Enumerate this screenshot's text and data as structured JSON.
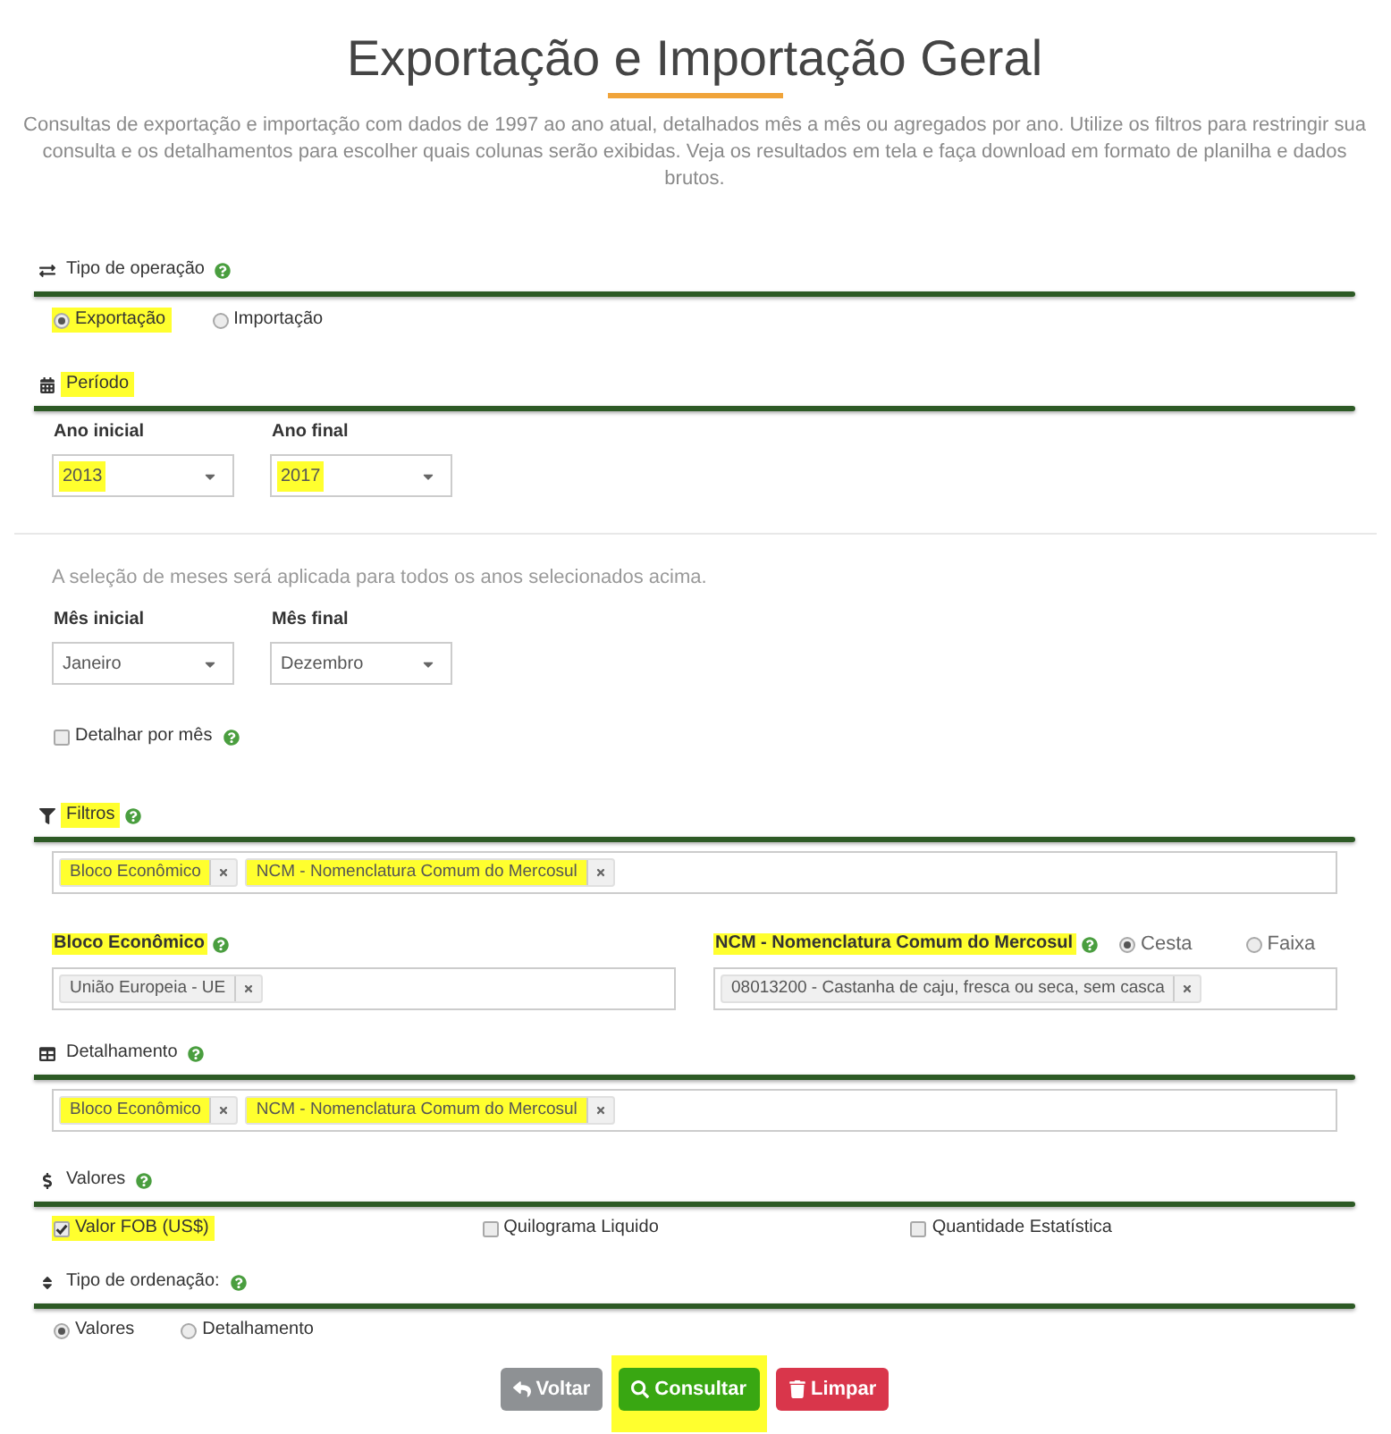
{
  "header": {
    "title": "Exportação e Importação Geral",
    "description": "Consultas de exportação e importação com dados de 1997 ao ano atual, detalhados mês a mês ou agregados por ano. Utilize os filtros para restringir sua consulta e os detalhamentos para escolher quais colunas serão exibidas. Veja os resultados em tela e faça download em formato de planilha e dados brutos."
  },
  "operation_type": {
    "title": "Tipo de operação",
    "help": true,
    "highlighted": false,
    "options": [
      {
        "label": "Exportação",
        "selected": true,
        "highlighted": true
      },
      {
        "label": "Importação",
        "selected": false,
        "highlighted": false
      }
    ]
  },
  "period": {
    "title": "Período",
    "help": false,
    "highlighted": true,
    "years": [
      {
        "label": "Ano inicial",
        "value": "2013",
        "highlighted": true
      },
      {
        "label": "Ano final",
        "value": "2017",
        "highlighted": true
      }
    ],
    "months_note": "A seleção de meses será aplicada para todos os anos selecionados acima.",
    "months": [
      {
        "label": "Mês inicial",
        "value": "Janeiro",
        "highlighted": false
      },
      {
        "label": "Mês final",
        "value": "Dezembro",
        "highlighted": false
      }
    ],
    "monthly_detail": {
      "label": "Detalhar por mês",
      "checked": false,
      "help": true
    }
  },
  "filters": {
    "title": "Filtros",
    "help": true,
    "highlighted": true,
    "tags": [
      {
        "label": "Bloco Econômico",
        "highlighted": true
      },
      {
        "label": "NCM - Nomenclatura Comum do Mercosul",
        "highlighted": true
      }
    ],
    "fields": [
      {
        "label": "Bloco Econômico",
        "help": true,
        "highlighted": true,
        "tags": [
          {
            "label": "União Europeia - UE",
            "highlighted": false
          }
        ]
      },
      {
        "label": "NCM - Nomenclatura Comum do Mercosul",
        "help": true,
        "highlighted": true,
        "modes": [
          {
            "label": "Cesta",
            "selected": true
          },
          {
            "label": "Faixa",
            "selected": false
          }
        ],
        "tags": [
          {
            "label": "08013200 - Castanha de caju, fresca ou seca, sem casca",
            "highlighted": false
          }
        ]
      }
    ]
  },
  "detail": {
    "title": "Detalhamento",
    "help": true,
    "highlighted": false,
    "tags": [
      {
        "label": "Bloco Econômico",
        "highlighted": true
      },
      {
        "label": "NCM - Nomenclatura Comum do Mercosul",
        "highlighted": true
      }
    ]
  },
  "values": {
    "title": "Valores",
    "help": true,
    "highlighted": false,
    "options": [
      {
        "label": "Valor FOB (US$)",
        "checked": true,
        "highlighted": true
      },
      {
        "label": "Quilograma Liquido",
        "checked": false,
        "highlighted": false
      },
      {
        "label": "Quantidade Estatística",
        "checked": false,
        "highlighted": false
      }
    ]
  },
  "ordering": {
    "title": "Tipo de ordenação:",
    "help": true,
    "highlighted": false,
    "options": [
      {
        "label": "Valores",
        "selected": true,
        "highlighted": false
      },
      {
        "label": "Detalhamento",
        "selected": false,
        "highlighted": false
      }
    ]
  },
  "buttons": [
    {
      "kind": "back",
      "label": "Voltar",
      "highlighted": false
    },
    {
      "kind": "search",
      "label": "Consultar",
      "highlighted": true
    },
    {
      "kind": "clear",
      "label": "Limpar",
      "highlighted": false
    }
  ]
}
